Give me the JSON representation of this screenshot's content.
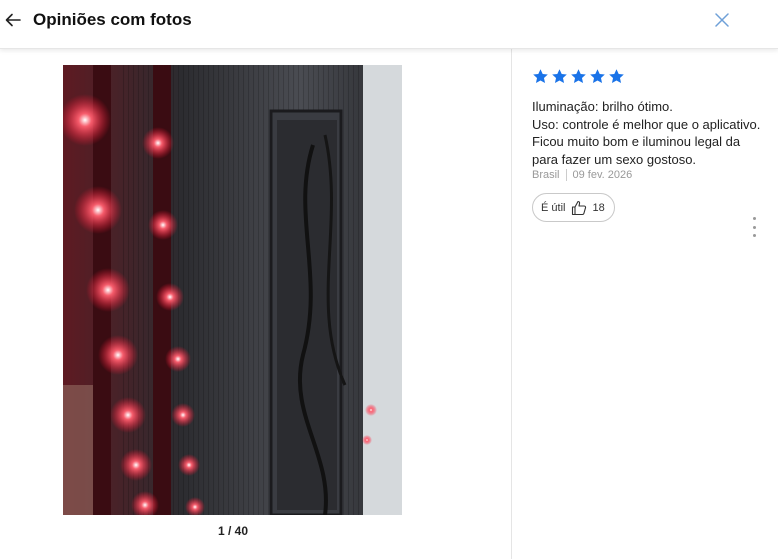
{
  "header": {
    "title": "Opiniões com fotos",
    "back_icon": "arrow-left-icon",
    "close_icon": "close-icon"
  },
  "gallery": {
    "counter": "1 / 40",
    "current_index": 1,
    "total": 40
  },
  "review": {
    "rating": 5,
    "rating_max": 5,
    "star_color": "#1a73e8",
    "lines": [
      "Iluminação: brilho ótimo.",
      "Uso: controle é melhor que o aplicativo.",
      "Ficou muito bom e iluminou legal da para fazer um sexo gostoso."
    ],
    "country": "Brasil",
    "date": "09 fev. 2026",
    "useful_label": "É útil",
    "useful_count": "18"
  },
  "colors": {
    "close_icon": "#6fa0d8",
    "led_red": "#ff2a3a"
  }
}
